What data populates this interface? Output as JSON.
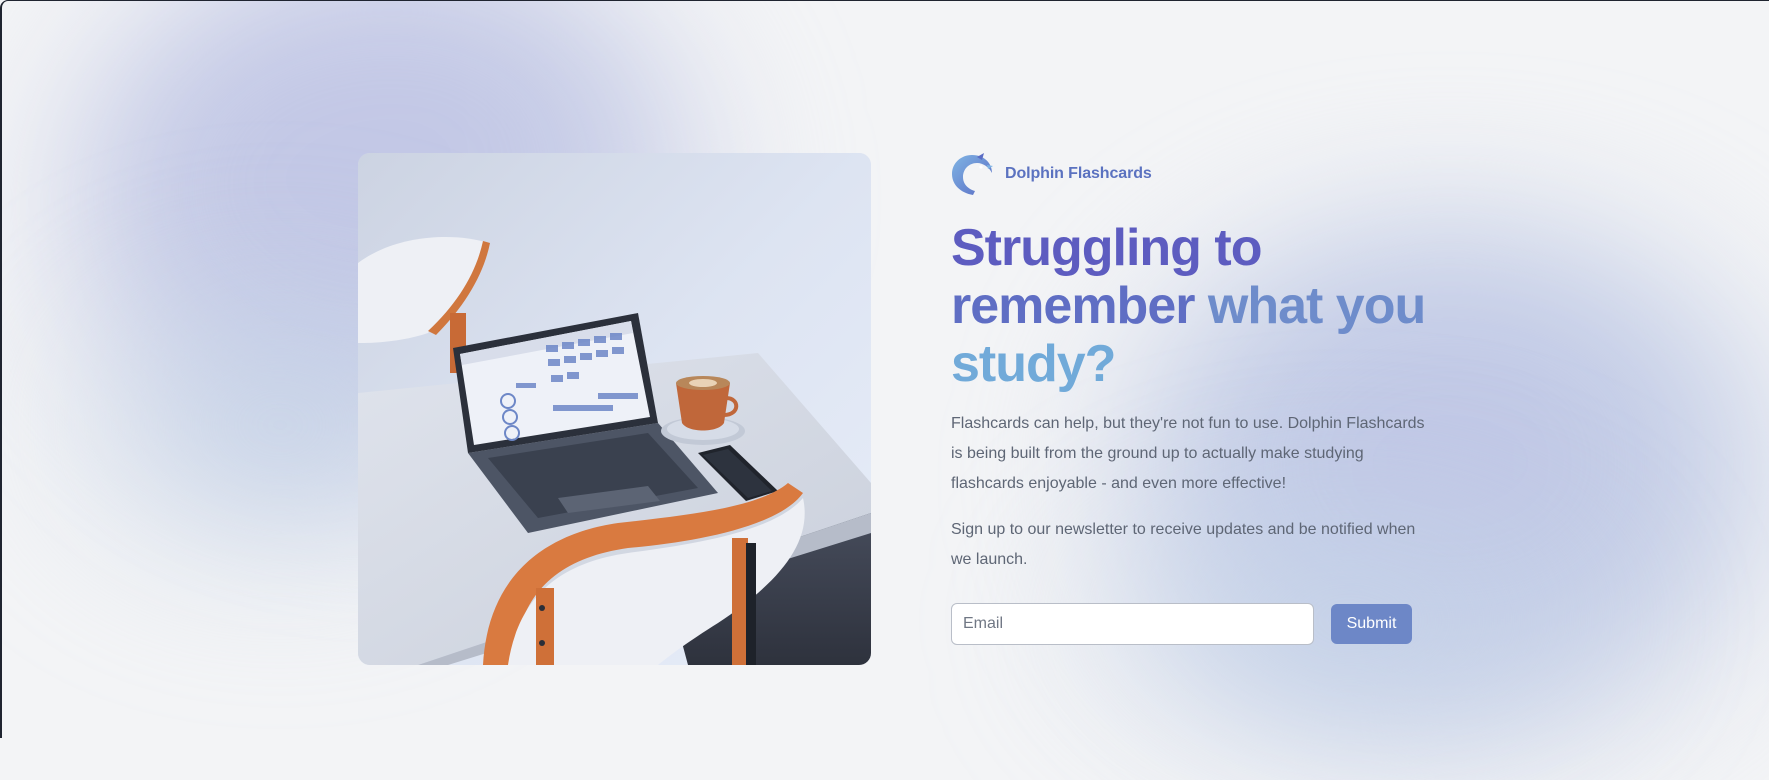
{
  "brand": {
    "name": "Dolphin Flashcards",
    "logo_icon": "dolphin-logo-icon"
  },
  "hero": {
    "headline_line1": "Struggling to",
    "headline_line2a": "remember",
    "headline_line2b": " what you",
    "headline_line3": "study?",
    "description": "Flashcards can help, but they're not fun to use. Dolphin Flashcards is being built from the ground up to actually make studying flashcards enjoyable - and even more effective!",
    "newsletter_text": "Sign up to our newsletter to receive updates and be notified when we launch."
  },
  "signup_form": {
    "email_placeholder": "Email",
    "email_value": "",
    "submit_label": "Submit"
  },
  "colors": {
    "background": "#f3f4f6",
    "brand": "#5b72c0",
    "headline_start": "#5d5cc0",
    "headline_end": "#71aad9",
    "button": "#6d87c7",
    "body_text": "#5e6675"
  },
  "hero_image": {
    "description_icon": "laptop-coffee-photo"
  }
}
